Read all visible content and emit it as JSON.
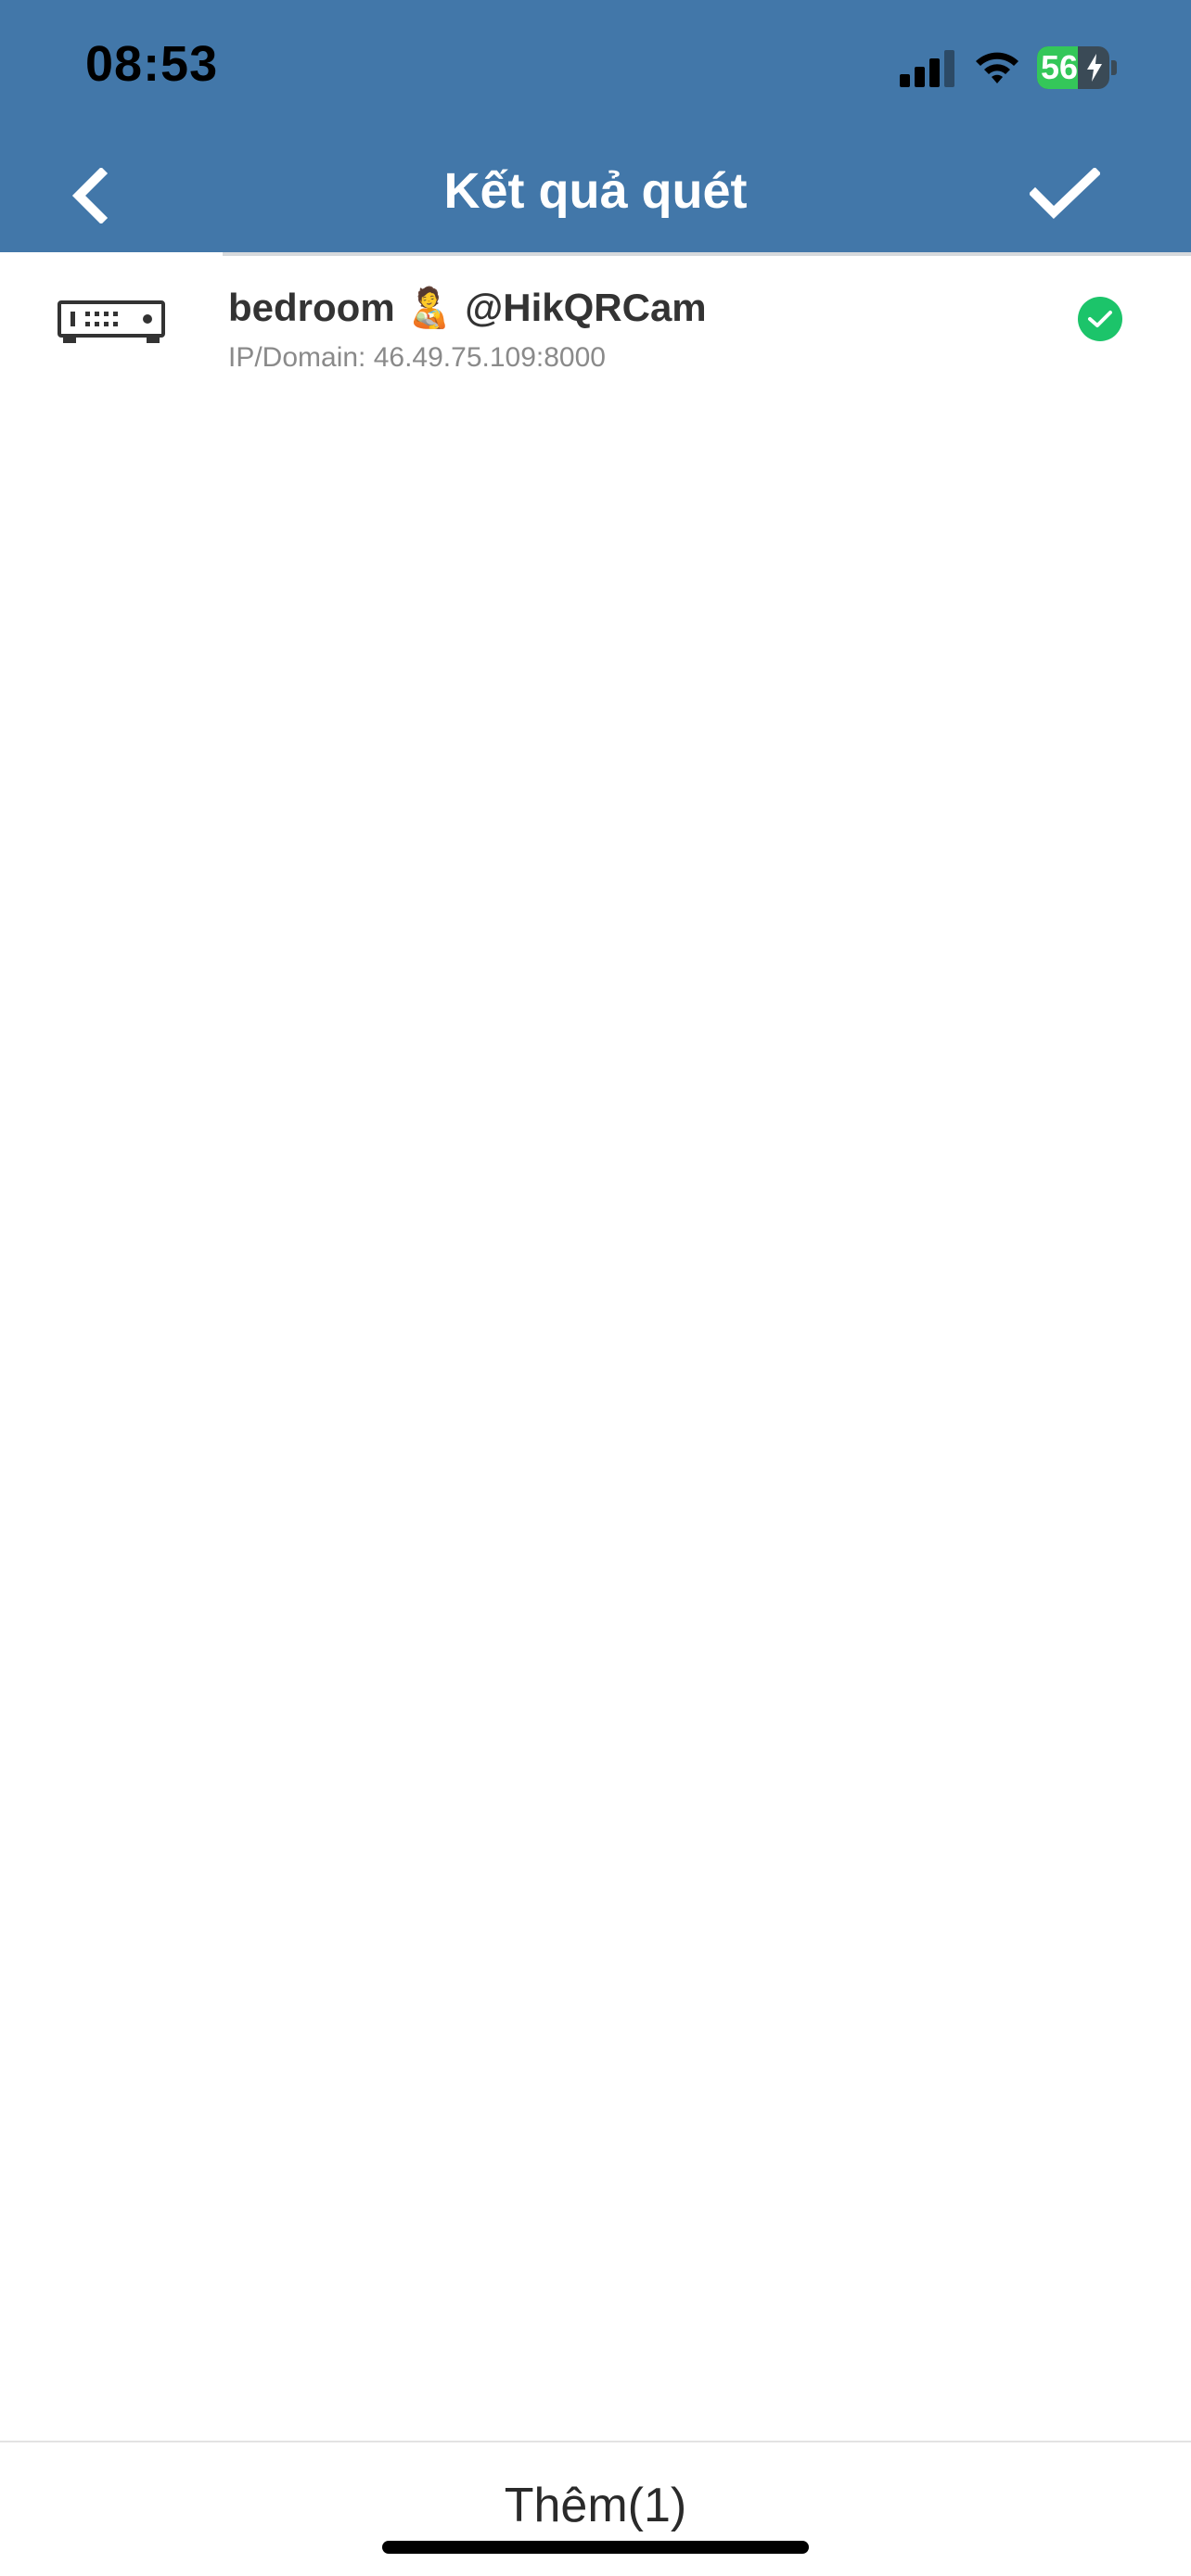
{
  "status_bar": {
    "time": "08:53",
    "battery_level": "56",
    "battery_fraction": 0.56,
    "signal_icon": "cellular-signal-icon",
    "wifi_icon": "wifi-icon",
    "charging_icon": "charging-bolt-icon"
  },
  "nav": {
    "title": "Kết quả quét",
    "back_icon": "chevron-left-icon",
    "confirm_icon": "checkmark-icon"
  },
  "devices": [
    {
      "name": "bedroom 🧑‍🍼 @HikQRCam",
      "ip_line": "IP/Domain: 46.49.75.109:8000",
      "icon": "nvr-device-icon",
      "selected_icon": "check-circle-icon",
      "selected": true
    }
  ],
  "footer": {
    "add_label": "Thêm(1)"
  },
  "colors": {
    "header_bg": "#4277a9",
    "accent_green": "#1cc46a",
    "battery_green": "#34c759",
    "title_text": "#333333",
    "secondary_text": "#8a8a8a"
  }
}
